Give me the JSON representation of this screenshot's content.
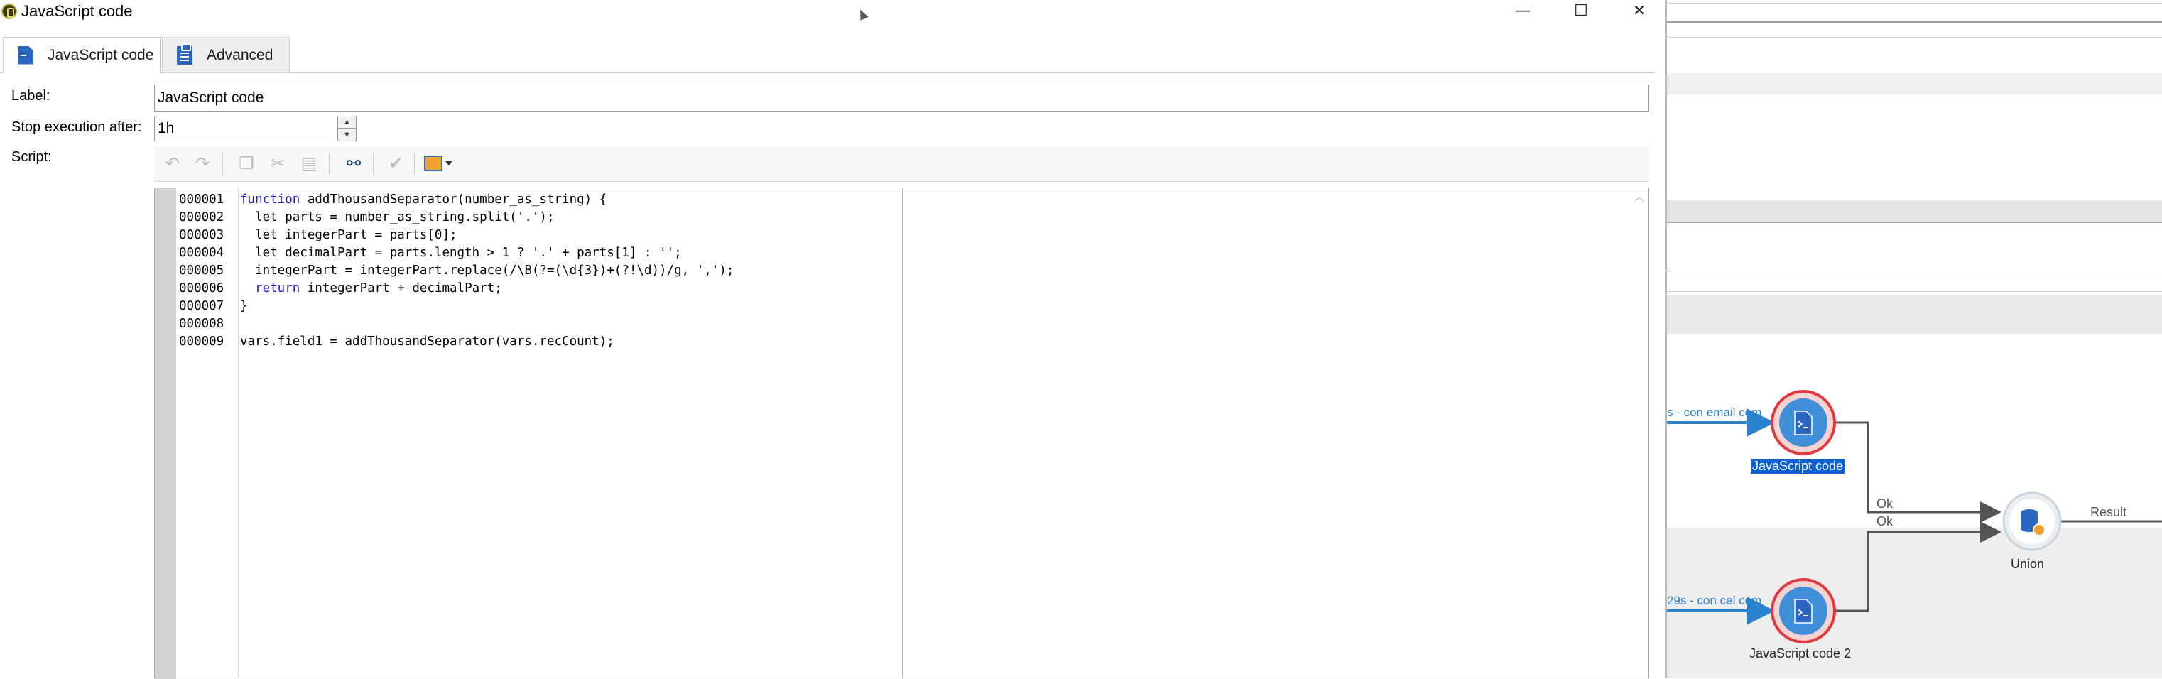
{
  "window": {
    "title": "JavaScript code",
    "controls": {
      "minimize": "—",
      "maximize": "☐",
      "close": "✕"
    }
  },
  "tabs": [
    {
      "label": "JavaScript code",
      "icon": "document-icon",
      "active": true
    },
    {
      "label": "Advanced",
      "icon": "clipboard-icon",
      "active": false
    }
  ],
  "form": {
    "label_caption": "Label:",
    "label_value": "JavaScript code",
    "stop_caption": "Stop execution after:",
    "stop_value": "1h",
    "script_caption": "Script:"
  },
  "toolbar": {
    "buttons": [
      "undo-icon",
      "redo-icon",
      "copy-icon",
      "cut-icon",
      "paste-icon",
      "find-icon",
      "check-icon",
      "insert-field-icon"
    ]
  },
  "editor": {
    "line_numbers": [
      "000001",
      "000002",
      "000003",
      "000004",
      "000005",
      "000006",
      "000007",
      "000008",
      "000009"
    ],
    "lines": [
      [
        {
          "t": "function",
          "kw": true
        },
        {
          "t": " addThousandSeparator(number_as_string) {"
        }
      ],
      [
        {
          "t": "  let parts = number_as_string.split('.');"
        }
      ],
      [
        {
          "t": "  let integerPart = parts[0];"
        }
      ],
      [
        {
          "t": "  let decimalPart = parts.length > 1 ? '.' + parts[1] : '';"
        }
      ],
      [
        {
          "t": "  integerPart = integerPart.replace(/\\B(?=(\\d{3})+(?!\\d))/g, ',');"
        }
      ],
      [
        {
          "t": "  ",
          "kw": false
        },
        {
          "t": "return",
          "kw": true
        },
        {
          "t": " integerPart + decimalPart;"
        }
      ],
      [
        {
          "t": "}"
        }
      ],
      [
        {
          "t": ""
        }
      ],
      [
        {
          "t": "vars.field1 = addThousandSeparator(vars.recCount);"
        }
      ]
    ]
  },
  "workflow": {
    "incoming_link_1": "s - con email com",
    "incoming_link_2": "29s - con cel com",
    "node1": "JavaScript code",
    "node2": "JavaScript code 2",
    "union": "Union",
    "ok_1": "Ok",
    "ok_2": "Ok",
    "result": "Result",
    "colors": {
      "node_ring": "#e0393e",
      "node_fill": "#3f8fd8",
      "link": "#2b82cf",
      "selection": "#0b62d6"
    }
  }
}
